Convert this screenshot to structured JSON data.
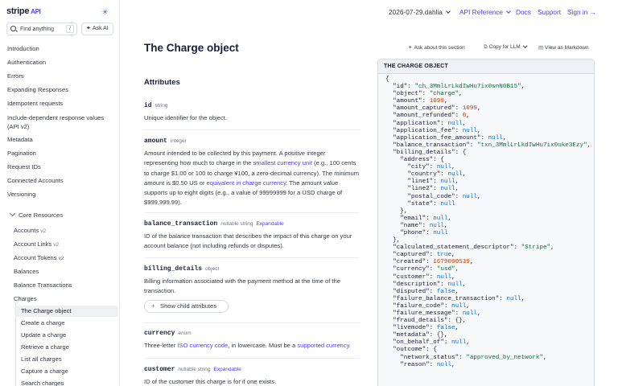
{
  "sidebar": {
    "logo": "stripe",
    "logo_suffix": "API",
    "search_placeholder": "Find anything",
    "search_shortcut": "/",
    "ask_ai": "Ask AI",
    "top_items": [
      {
        "label": "Introduction"
      },
      {
        "label": "Authentication"
      },
      {
        "label": "Errors"
      },
      {
        "label": "Expanding Responses"
      },
      {
        "label": "Idempotent requests"
      },
      {
        "label": "Include-dependent response values (API v2)"
      },
      {
        "label": "Metadata"
      },
      {
        "label": "Pagination"
      },
      {
        "label": "Request IDs"
      },
      {
        "label": "Connected Accounts"
      },
      {
        "label": "Versioning"
      }
    ],
    "section": "Core Resources",
    "core_items": [
      {
        "label": "Accounts",
        "badge": "v2"
      },
      {
        "label": "Account Links",
        "badge": "v2"
      },
      {
        "label": "Account Tokens",
        "badge": "v2"
      },
      {
        "label": "Balances"
      },
      {
        "label": "Balance Transactions"
      },
      {
        "label": "Charges"
      }
    ],
    "charges_items": [
      "The Charge object",
      "Create a charge",
      "Update a charge",
      "Retrieve a charge",
      "List all charges",
      "Capture a charge",
      "Search charges"
    ]
  },
  "topbar": {
    "version": "2026-07-29.dahlia",
    "api_reference": "API Reference",
    "docs": "Docs",
    "support": "Support",
    "sign_in": "Sign in →"
  },
  "main": {
    "title": "The Charge object",
    "attributes_heading": "Attributes",
    "fields": {
      "id": {
        "name": "id",
        "type": "string",
        "desc": "Unique identifier for the object."
      },
      "amount": {
        "name": "amount",
        "type": "integer",
        "desc_1": "Amount intended to be collected by this payment. A positive integer representing how much to charge in the ",
        "link_1": "smallest currency unit",
        "desc_2": " (e.g., 100 cents to charge $1.00 or 100 to charge ¥100, a zero-decimal currency). The minimum amount is $0.50 US or ",
        "link_2": "equivalent in charge currency",
        "desc_3": ". The amount value supports up to eight digits (e.g., a value of 99999999 for a USD charge of $999,999.99)."
      },
      "balance_transaction": {
        "name": "balance_transaction",
        "type": "nullable string",
        "expandable": "Expandable",
        "desc": "ID of the balance transaction that describes the impact of this charge on your account balance (not including refunds or disputes)."
      },
      "billing_details": {
        "name": "billing_details",
        "type": "object",
        "desc": "Billing information associated with the payment method at the time of the transaction."
      },
      "child_button": "Show child attributes",
      "currency": {
        "name": "currency",
        "type": "enum",
        "desc_1": "Three-letter ",
        "link_1": "ISO currency code",
        "desc_2": ", in lowercase. Must be a ",
        "link_2": "supported currency",
        "desc_3": "."
      },
      "customer": {
        "name": "customer",
        "type": "nullable string",
        "expandable": "Expandable",
        "desc": "ID of the customer this charge is for if one exists."
      }
    }
  },
  "panel": {
    "ask_section": "Ask about this section",
    "copy_llm": "Copy for LLM",
    "markdown": "View as Markdown",
    "header": "THE CHARGE OBJECT",
    "code": [
      "{",
      "  \"id\": \"ch_3MmlLrLkdIwHu7ix0snN0B15\",",
      "  \"object\": \"charge\",",
      "  \"amount\": 1099,",
      "  \"amount_captured\": 1099,",
      "  \"amount_refunded\": 0,",
      "  \"application\": null,",
      "  \"application_fee\": null,",
      "  \"application_fee_amount\": null,",
      "  \"balance_transaction\": \"txn_3MmlLrLkdIwHu7ix0uke3Ezy\",",
      "  \"billing_details\": {",
      "    \"address\": {",
      "      \"city\": null,",
      "      \"country\": null,",
      "      \"line1\": null,",
      "      \"line2\": null,",
      "      \"postal_code\": null,",
      "      \"state\": null",
      "    },",
      "    \"email\": null,",
      "    \"name\": null,",
      "    \"phone\": null",
      "  },",
      "  \"calculated_statement_descriptor\": \"Stripe\",",
      "  \"captured\": true,",
      "  \"created\": 1679090539,",
      "  \"currency\": \"usd\",",
      "  \"customer\": null,",
      "  \"description\": null,",
      "  \"disputed\": false,",
      "  \"failure_balance_transaction\": null,",
      "  \"failure_code\": null,",
      "  \"failure_message\": null,",
      "  \"fraud_details\": {},",
      "  \"livemode\": false,",
      "  \"metadata\": {},",
      "  \"on_behalf_of\": null,",
      "  \"outcome\": {",
      "    \"network_status\": \"approved_by_network\",",
      "    \"reason\": null,"
    ]
  }
}
